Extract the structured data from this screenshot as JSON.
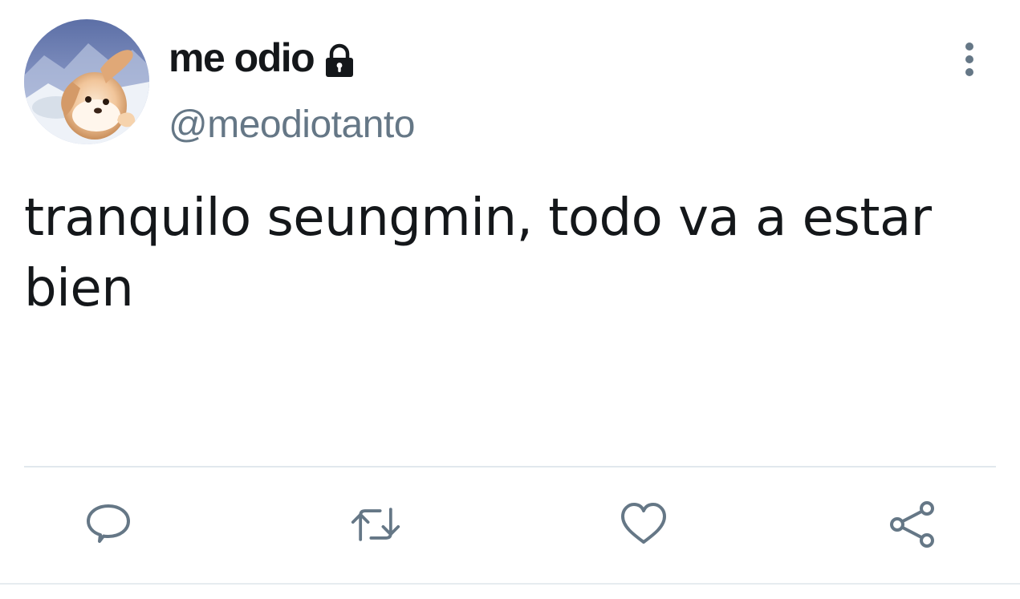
{
  "user": {
    "display_name": "me odio",
    "handle": "@meodiotanto",
    "protected_icon": "lock-icon",
    "avatar_icon": "puppy-avatar"
  },
  "tweet": {
    "text": "tranquilo seungmin, todo va a estar bien"
  },
  "menu_icon": "more-vertical-icon",
  "actions": [
    {
      "name": "reply",
      "icon": "comment-bubble-icon"
    },
    {
      "name": "retweet",
      "icon": "retweet-icon"
    },
    {
      "name": "like",
      "icon": "heart-icon"
    },
    {
      "name": "share",
      "icon": "share-icon"
    }
  ],
  "colors": {
    "text_primary": "#14171a",
    "text_secondary": "#657786",
    "icon": "#657786",
    "divider": "#e1e8ed"
  }
}
